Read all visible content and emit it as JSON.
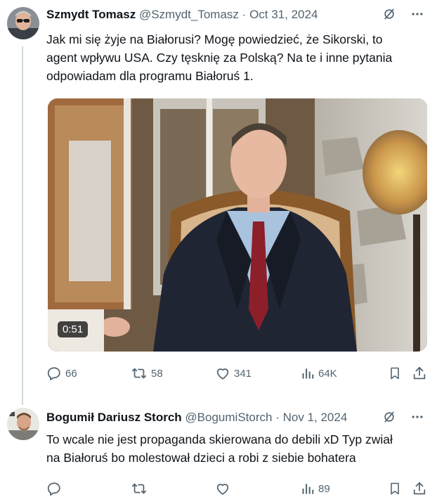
{
  "tweet1": {
    "name": "Szmydt Tomasz",
    "handle": "@Szmydt_Tomasz",
    "dot": "·",
    "date": "Oct 31, 2024",
    "text_line1": "Jak mi się żyje na Białorusi? Mogę powiedzieć, że Sikorski, to",
    "text_line2": "agent wpływu USA. Czy tęsknię za Polską? Na te i inne pytania",
    "text_line3": "odpowiadam dla programu Białoruś 1.",
    "video_duration": "0:51",
    "replies": "66",
    "reposts": "58",
    "likes": "341",
    "views": "64K"
  },
  "tweet2": {
    "name": "Bogumił Dariusz Storch",
    "handle": "@BogumiStorch",
    "dot": "·",
    "date": "Nov 1, 2024",
    "text_line1": "To wcale nie jest propaganda skierowana do debili xD Typ zwiał",
    "text_line2": "na Białoruś bo molestował dzieci a robi z siebie bohatera",
    "views": "89"
  },
  "icons": {
    "grok": "grok-icon",
    "more": "more-icon",
    "reply": "reply-icon",
    "repost": "repost-icon",
    "like": "like-icon",
    "views": "views-icon",
    "bookmark": "bookmark-icon",
    "share": "share-icon"
  },
  "colors": {
    "text": "#0f1419",
    "secondary": "#536471",
    "thread_line": "#cfd9de"
  }
}
